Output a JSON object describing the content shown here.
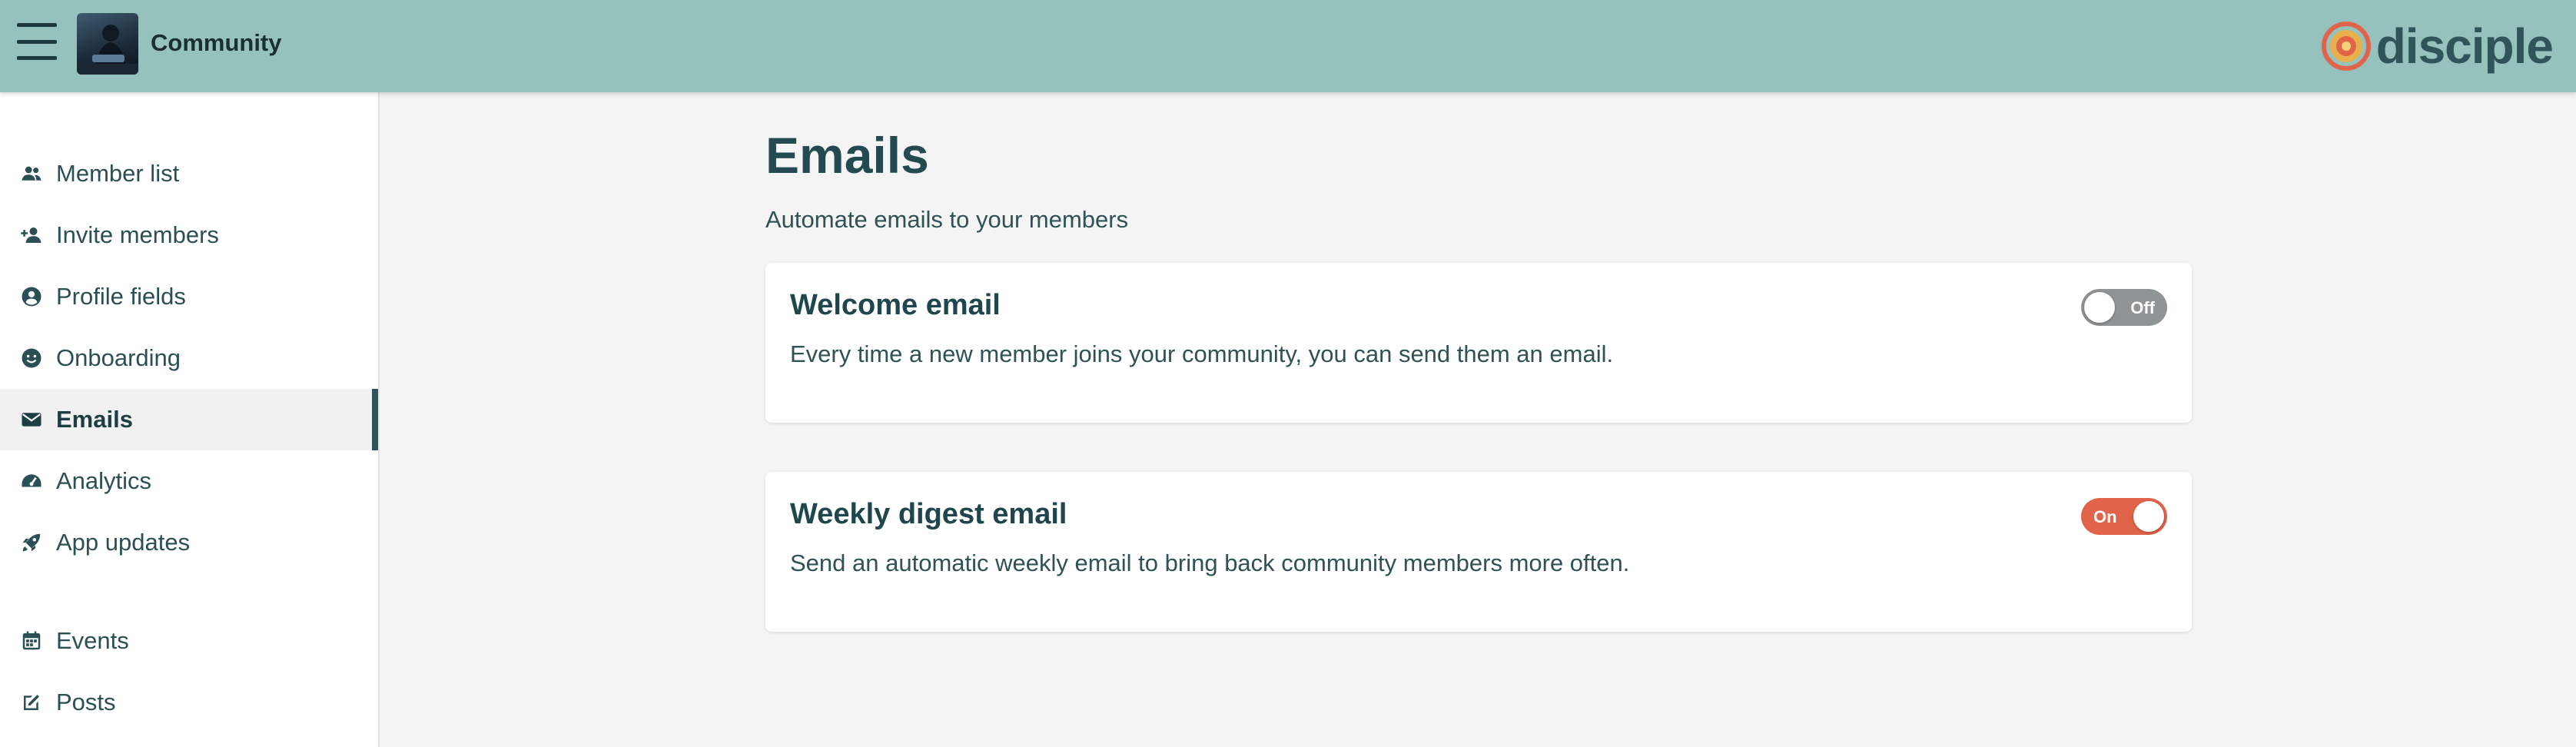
{
  "header": {
    "community_name": "Community",
    "brand": "disciple",
    "brand_color": "#2f555b",
    "accent_color": "#e0644a",
    "bar_color": "#95c2bc"
  },
  "sidebar": {
    "items": [
      {
        "label": "Member list",
        "icon": "members-icon"
      },
      {
        "label": "Invite members",
        "icon": "add-person-icon"
      },
      {
        "label": "Profile fields",
        "icon": "profile-icon"
      },
      {
        "label": "Onboarding",
        "icon": "smiley-icon"
      },
      {
        "label": "Emails",
        "icon": "mail-icon",
        "active": true
      },
      {
        "label": "Analytics",
        "icon": "gauge-icon"
      },
      {
        "label": "App updates",
        "icon": "rocket-icon"
      },
      {
        "label": "Events",
        "icon": "calendar-icon"
      },
      {
        "label": "Posts",
        "icon": "edit-icon"
      }
    ]
  },
  "main": {
    "title": "Emails",
    "subtitle": "Automate emails to your members",
    "cards": [
      {
        "title": "Welcome email",
        "description": "Every time a new member joins your community, you can send them an email.",
        "toggle": "Off"
      },
      {
        "title": "Weekly digest email",
        "description": "Send an automatic weekly email to bring back community members more often.",
        "toggle": "On"
      }
    ]
  }
}
